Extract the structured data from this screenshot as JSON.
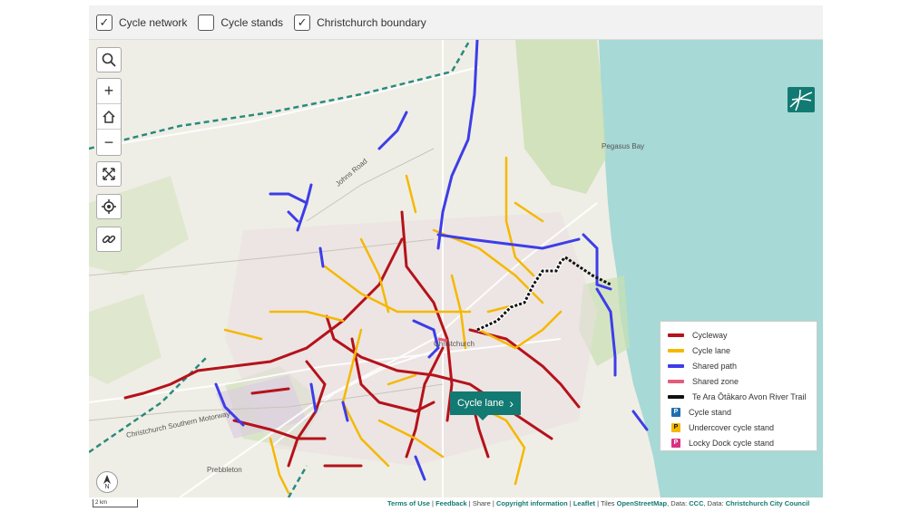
{
  "layers": [
    {
      "label": "Cycle network",
      "checked": true,
      "mark": "✓"
    },
    {
      "label": "Cycle stands",
      "checked": false,
      "mark": ""
    },
    {
      "label": "Christchurch boundary",
      "checked": true,
      "mark": "✓"
    }
  ],
  "controls": {
    "search_icon": "search-icon",
    "zoom_in": "+",
    "home_icon": "home-icon",
    "zoom_out": "−",
    "fullscreen_icon": "expand-icon",
    "locate_icon": "crosshair-icon",
    "link_icon": "link-icon",
    "north_label": "N"
  },
  "map_labels": {
    "city": "Christchurch",
    "bay": "Pegasus Bay",
    "road1": "Johns Road",
    "road2": "Christchurch Southern Motorway",
    "suburb": "Prebbleton"
  },
  "tooltip": {
    "label": "Cycle lane",
    "chevron": "›"
  },
  "legend": [
    {
      "label": "Cycleway",
      "kind": "line",
      "color": "#b5121b"
    },
    {
      "label": "Cycle lane",
      "kind": "line",
      "color": "#f5b800"
    },
    {
      "label": "Shared path",
      "kind": "line",
      "color": "#3d3de8"
    },
    {
      "label": "Shared zone",
      "kind": "line",
      "color": "#e35d7a"
    },
    {
      "label": "Te Ara Ōtākaro Avon River Trail",
      "kind": "line",
      "color": "#111111"
    },
    {
      "label": "Cycle stand",
      "kind": "square",
      "color": "#1f6fae",
      "glyph": "P"
    },
    {
      "label": "Undercover cycle stand",
      "kind": "square",
      "color": "#f5b800",
      "glyph": "P"
    },
    {
      "label": "Locky Dock cycle stand",
      "kind": "square",
      "color": "#d63384",
      "glyph": "P"
    }
  ],
  "scale": "2 km",
  "attribution": {
    "terms": "Terms of Use",
    "sep1": " | ",
    "feedback": "Feedback",
    "sep2": " | Share | ",
    "copyright": "Copyright information",
    "sep3": " | ",
    "leaflet": "Leaflet",
    "tiles_prefix": " | Tiles ",
    "osm": "OpenStreetMap",
    "data1_prefix": ", Data: ",
    "ccc": "CCC",
    "data2_prefix": ", Data: ",
    "council": "Christchurch City Council"
  },
  "colors": {
    "sea": "#a7d9d6",
    "accent": "#127a72"
  }
}
